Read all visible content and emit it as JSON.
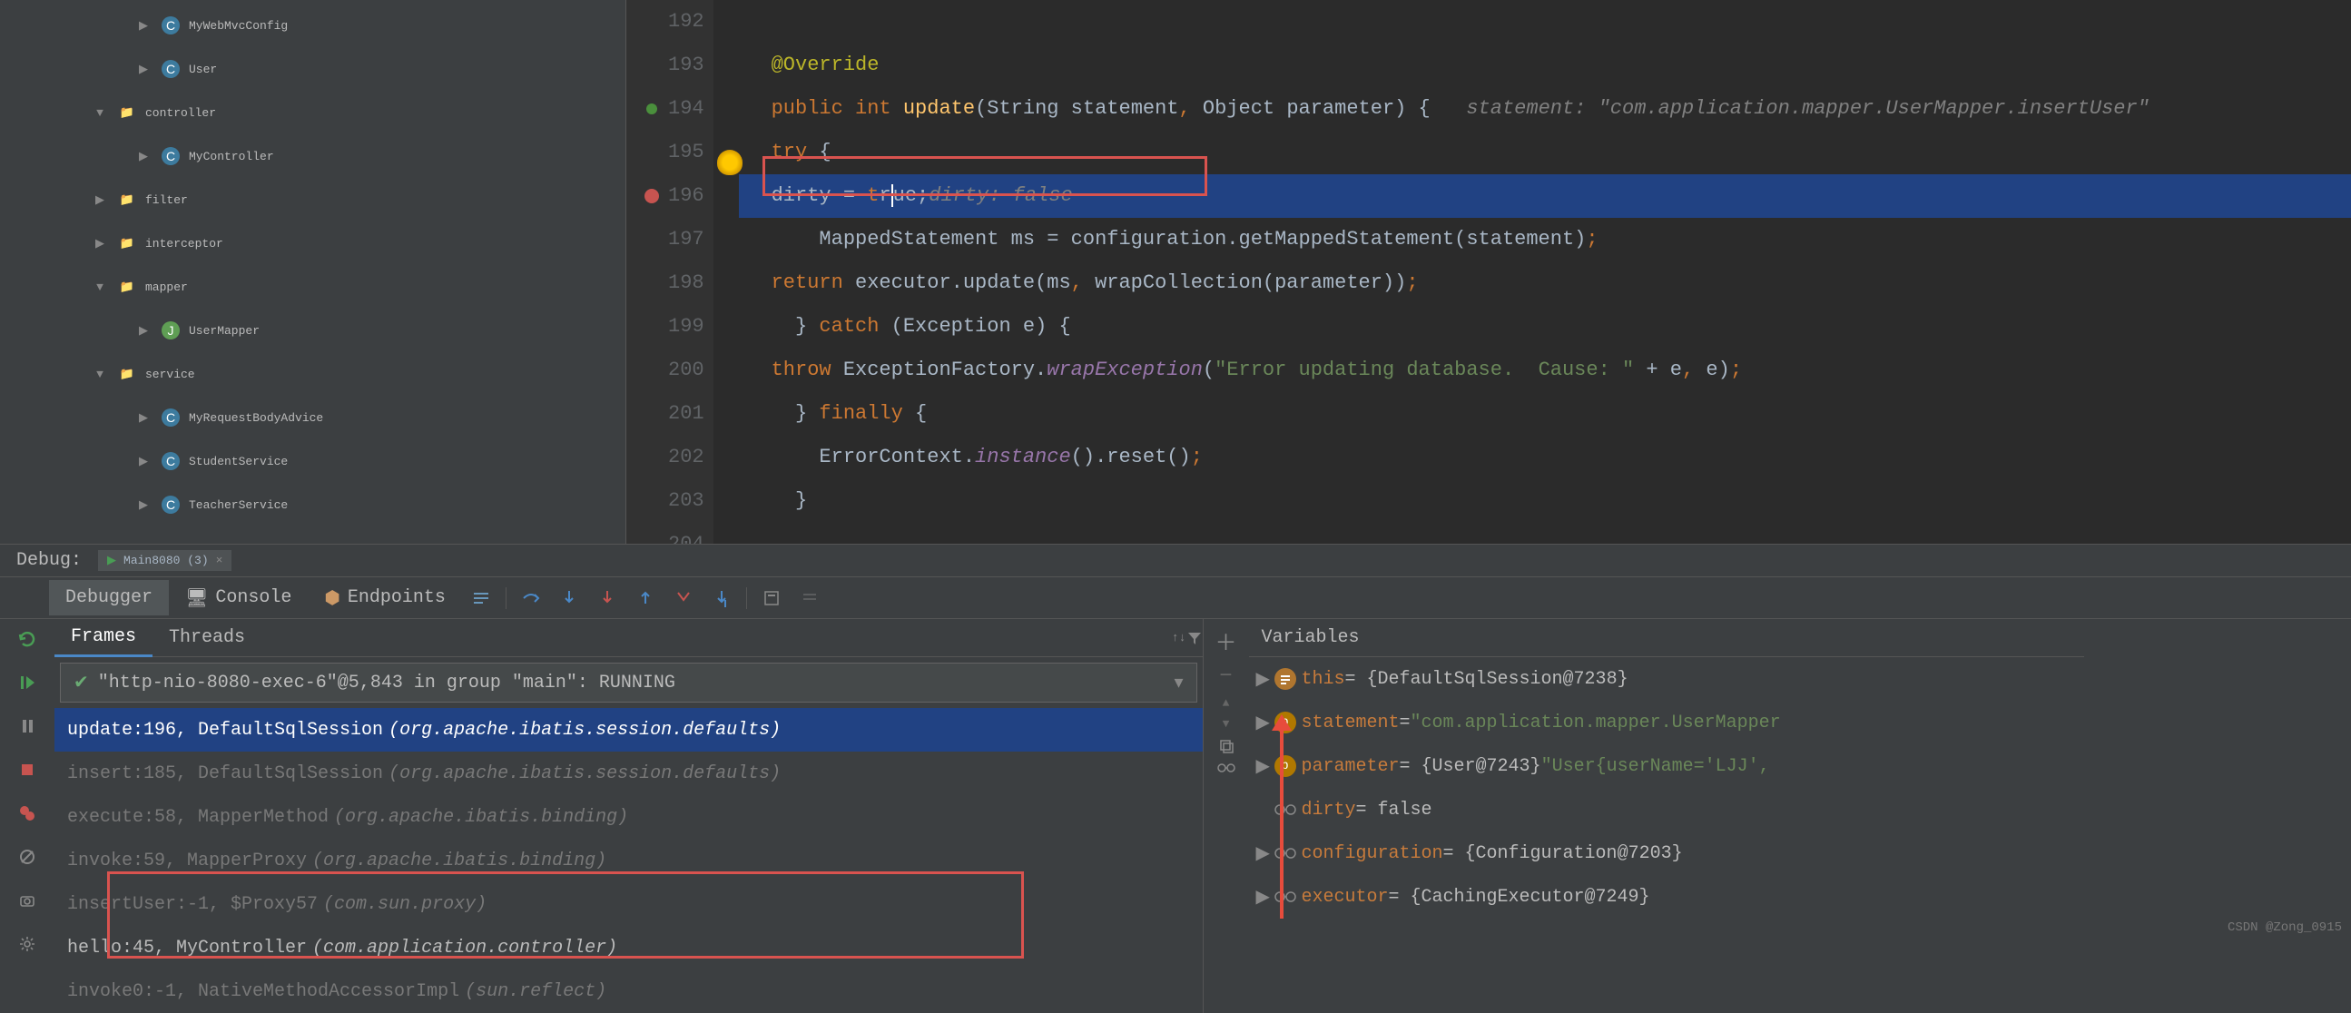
{
  "tree": {
    "items": [
      {
        "indent": 3,
        "chev": "▶",
        "icon": "class",
        "label": "MyWebMvcConfig"
      },
      {
        "indent": 3,
        "chev": "▶",
        "icon": "class",
        "label": "User"
      },
      {
        "indent": 2,
        "chev": "▼",
        "icon": "folder",
        "label": "controller"
      },
      {
        "indent": 3,
        "chev": "▶",
        "icon": "class",
        "label": "MyController"
      },
      {
        "indent": 2,
        "chev": "▶",
        "icon": "folder",
        "label": "filter"
      },
      {
        "indent": 2,
        "chev": "▶",
        "icon": "folder",
        "label": "interceptor"
      },
      {
        "indent": 2,
        "chev": "▼",
        "icon": "folder",
        "label": "mapper"
      },
      {
        "indent": 3,
        "chev": "▶",
        "icon": "interface",
        "label": "UserMapper"
      },
      {
        "indent": 2,
        "chev": "▼",
        "icon": "folder",
        "label": "service"
      },
      {
        "indent": 3,
        "chev": "▶",
        "icon": "class",
        "label": "MyRequestBodyAdvice"
      },
      {
        "indent": 3,
        "chev": "▶",
        "icon": "class",
        "label": "StudentService"
      },
      {
        "indent": 3,
        "chev": "▶",
        "icon": "class",
        "label": "TeacherService"
      }
    ]
  },
  "editor": {
    "first_line": 192,
    "highlighted_line": 196,
    "inline_hint_194": "statement: \"com.application.mapper.UserMapper.insertUser\"",
    "inline_hint_196": "dirty: false",
    "str_201": "\"Error updating database.  Cause: \""
  },
  "debug": {
    "label": "Debug:",
    "tab_name": "Main8080 (3)",
    "tabs": {
      "debugger": "Debugger",
      "console": "Console",
      "endpoints": "Endpoints"
    },
    "frames_label": "Frames",
    "threads_label": "Threads",
    "thread": "\"http-nio-8080-exec-6\"@5,843 in group \"main\": RUNNING",
    "frames": [
      {
        "txt": "update:196, DefaultSqlSession",
        "pkg": "(org.apache.ibatis.session.defaults)",
        "sel": true,
        "lib": true
      },
      {
        "txt": "insert:185, DefaultSqlSession",
        "pkg": "(org.apache.ibatis.session.defaults)",
        "lib": true
      },
      {
        "txt": "execute:58, MapperMethod",
        "pkg": "(org.apache.ibatis.binding)",
        "lib": true
      },
      {
        "txt": "invoke:59, MapperProxy",
        "pkg": "(org.apache.ibatis.binding)",
        "lib": true
      },
      {
        "txt": "insertUser:-1, $Proxy57",
        "pkg": "(com.sun.proxy)",
        "lib": true
      },
      {
        "txt": "hello:45, MyController",
        "pkg": "(com.application.controller)",
        "lib": false
      },
      {
        "txt": "invoke0:-1, NativeMethodAccessorImpl",
        "pkg": "(sun.reflect)",
        "lib": true
      }
    ]
  },
  "variables": {
    "title": "Variables",
    "items": [
      {
        "chev": "▶",
        "badge": "eq",
        "name": "this",
        "val": " = {DefaultSqlSession@7238}"
      },
      {
        "chev": "▶",
        "badge": "p",
        "name": "statement",
        "val": " = ",
        "str": "\"com.application.mapper.UserMapper"
      },
      {
        "chev": "▶",
        "badge": "p",
        "name": "parameter",
        "val": " = {User@7243} ",
        "str": "\"User{userName='LJJ',"
      },
      {
        "chev": "",
        "badge": "oo",
        "name": "dirty",
        "val": " = false"
      },
      {
        "chev": "▶",
        "badge": "oo",
        "name": "configuration",
        "val": " = {Configuration@7203}"
      },
      {
        "chev": "▶",
        "badge": "oo",
        "name": "executor",
        "val": " = {CachingExecutor@7249}"
      }
    ]
  },
  "watermark": "CSDN @Zong_0915"
}
